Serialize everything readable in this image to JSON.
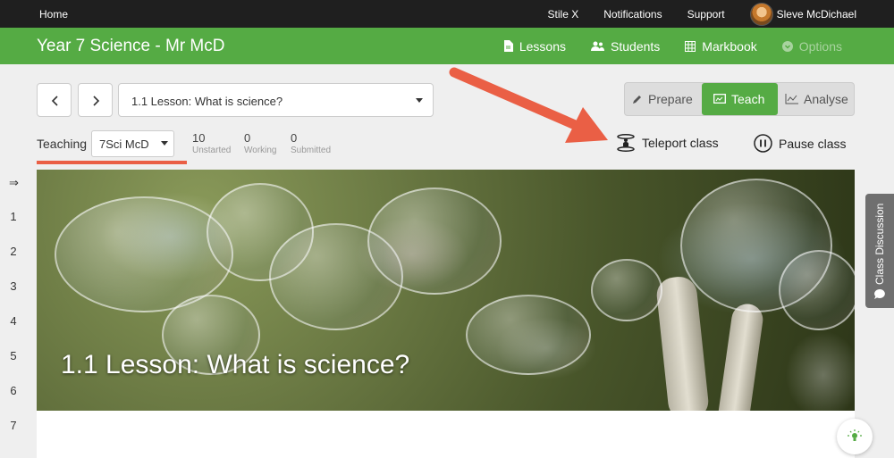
{
  "topbar": {
    "home": "Home",
    "links": [
      "Stile X",
      "Notifications",
      "Support"
    ],
    "user_name": "Sleve McDichael"
  },
  "header": {
    "class_title": "Year 7 Science - Mr McD",
    "nav": {
      "lessons": "Lessons",
      "students": "Students",
      "markbook": "Markbook",
      "options": "Options"
    }
  },
  "toolbar": {
    "lesson_selected": "1.1 Lesson: What is science?",
    "modes": {
      "prepare": "Prepare",
      "teach": "Teach",
      "analyse": "Analyse"
    },
    "active_mode": "Teach"
  },
  "teaching": {
    "label": "Teaching",
    "class_selected": "7Sci McD",
    "stats": [
      {
        "value": "10",
        "label": "Unstarted"
      },
      {
        "value": "0",
        "label": "Working"
      },
      {
        "value": "0",
        "label": "Submitted"
      }
    ],
    "teleport": "Teleport class",
    "pause": "Pause class"
  },
  "gutter": {
    "arrow": "⇒",
    "numbers": [
      "1",
      "2",
      "3",
      "4",
      "5",
      "6",
      "7"
    ]
  },
  "hero": {
    "title": "1.1 Lesson: What is science?"
  },
  "side_tab": {
    "label": "Class Discussion"
  },
  "colors": {
    "green": "#55ab44",
    "topbar": "#1f1f1f",
    "annotation": "#ea5f45"
  }
}
